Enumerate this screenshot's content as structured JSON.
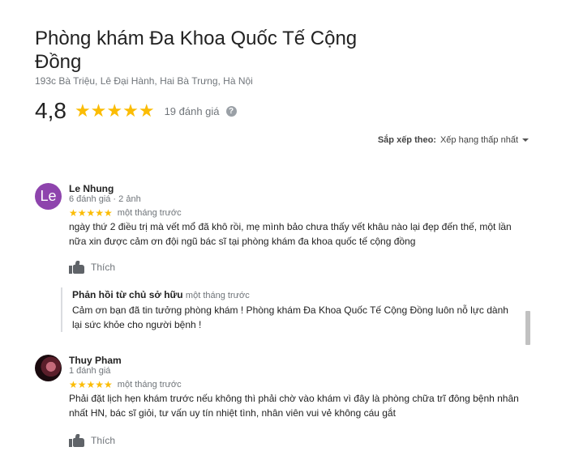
{
  "place": {
    "title": "Phòng khám Đa Khoa Quốc Tế Cộng Đồng",
    "address": "193c Bà Triệu, Lê Đại Hành, Hai Bà Trưng, Hà Nội",
    "rating": "4,8",
    "rating_stars": "★★★★★",
    "review_count": "19 đánh giá",
    "help_icon": "?"
  },
  "sort": {
    "label": "Sắp xếp theo:",
    "value": "Xếp hạng thấp nhất"
  },
  "reviews": [
    {
      "avatar_text": "Le",
      "avatar_color": "#8e44ad",
      "name": "Le Nhung",
      "meta": "6 đánh giá · 2 ảnh",
      "stars": "★★★★★",
      "time": "một tháng trước",
      "text": "ngày thứ 2 điều trị mà vết mổ đã khô rồi, mẹ mình bảo chưa thấy vết khâu nào lại đẹp đến thế, một lần nữa xin được cảm ơn đội ngũ bác sĩ tại phòng khám đa khoa quốc tế cộng đồng",
      "like_label": "Thích"
    },
    {
      "name": "Thuy Pham",
      "meta": "1 đánh giá",
      "stars": "★★★★★",
      "time": "một tháng trước",
      "text": "Phải đặt lịch hẹn khám trước nếu không thì phải chờ vào khám vì đây là phòng chữa trĩ đông bệnh nhân nhất HN, bác sĩ giỏi, tư vấn uy tín nhiệt tình, nhân viên vui vẻ không cáu gắt",
      "like_label": "Thích"
    }
  ],
  "owner_reply": {
    "label": "Phản hồi từ chủ sở hữu",
    "time": "một tháng trước",
    "text": "Cảm ơn bạn đã tin tưởng phòng khám ! Phòng khám Đa Khoa Quốc Tế Cộng Đồng luôn nỗ lực dành lại sức khỏe cho người bệnh !"
  },
  "colors": {
    "star": "#fbbc04",
    "secondary_text": "#70757a",
    "primary_text": "#222222"
  }
}
